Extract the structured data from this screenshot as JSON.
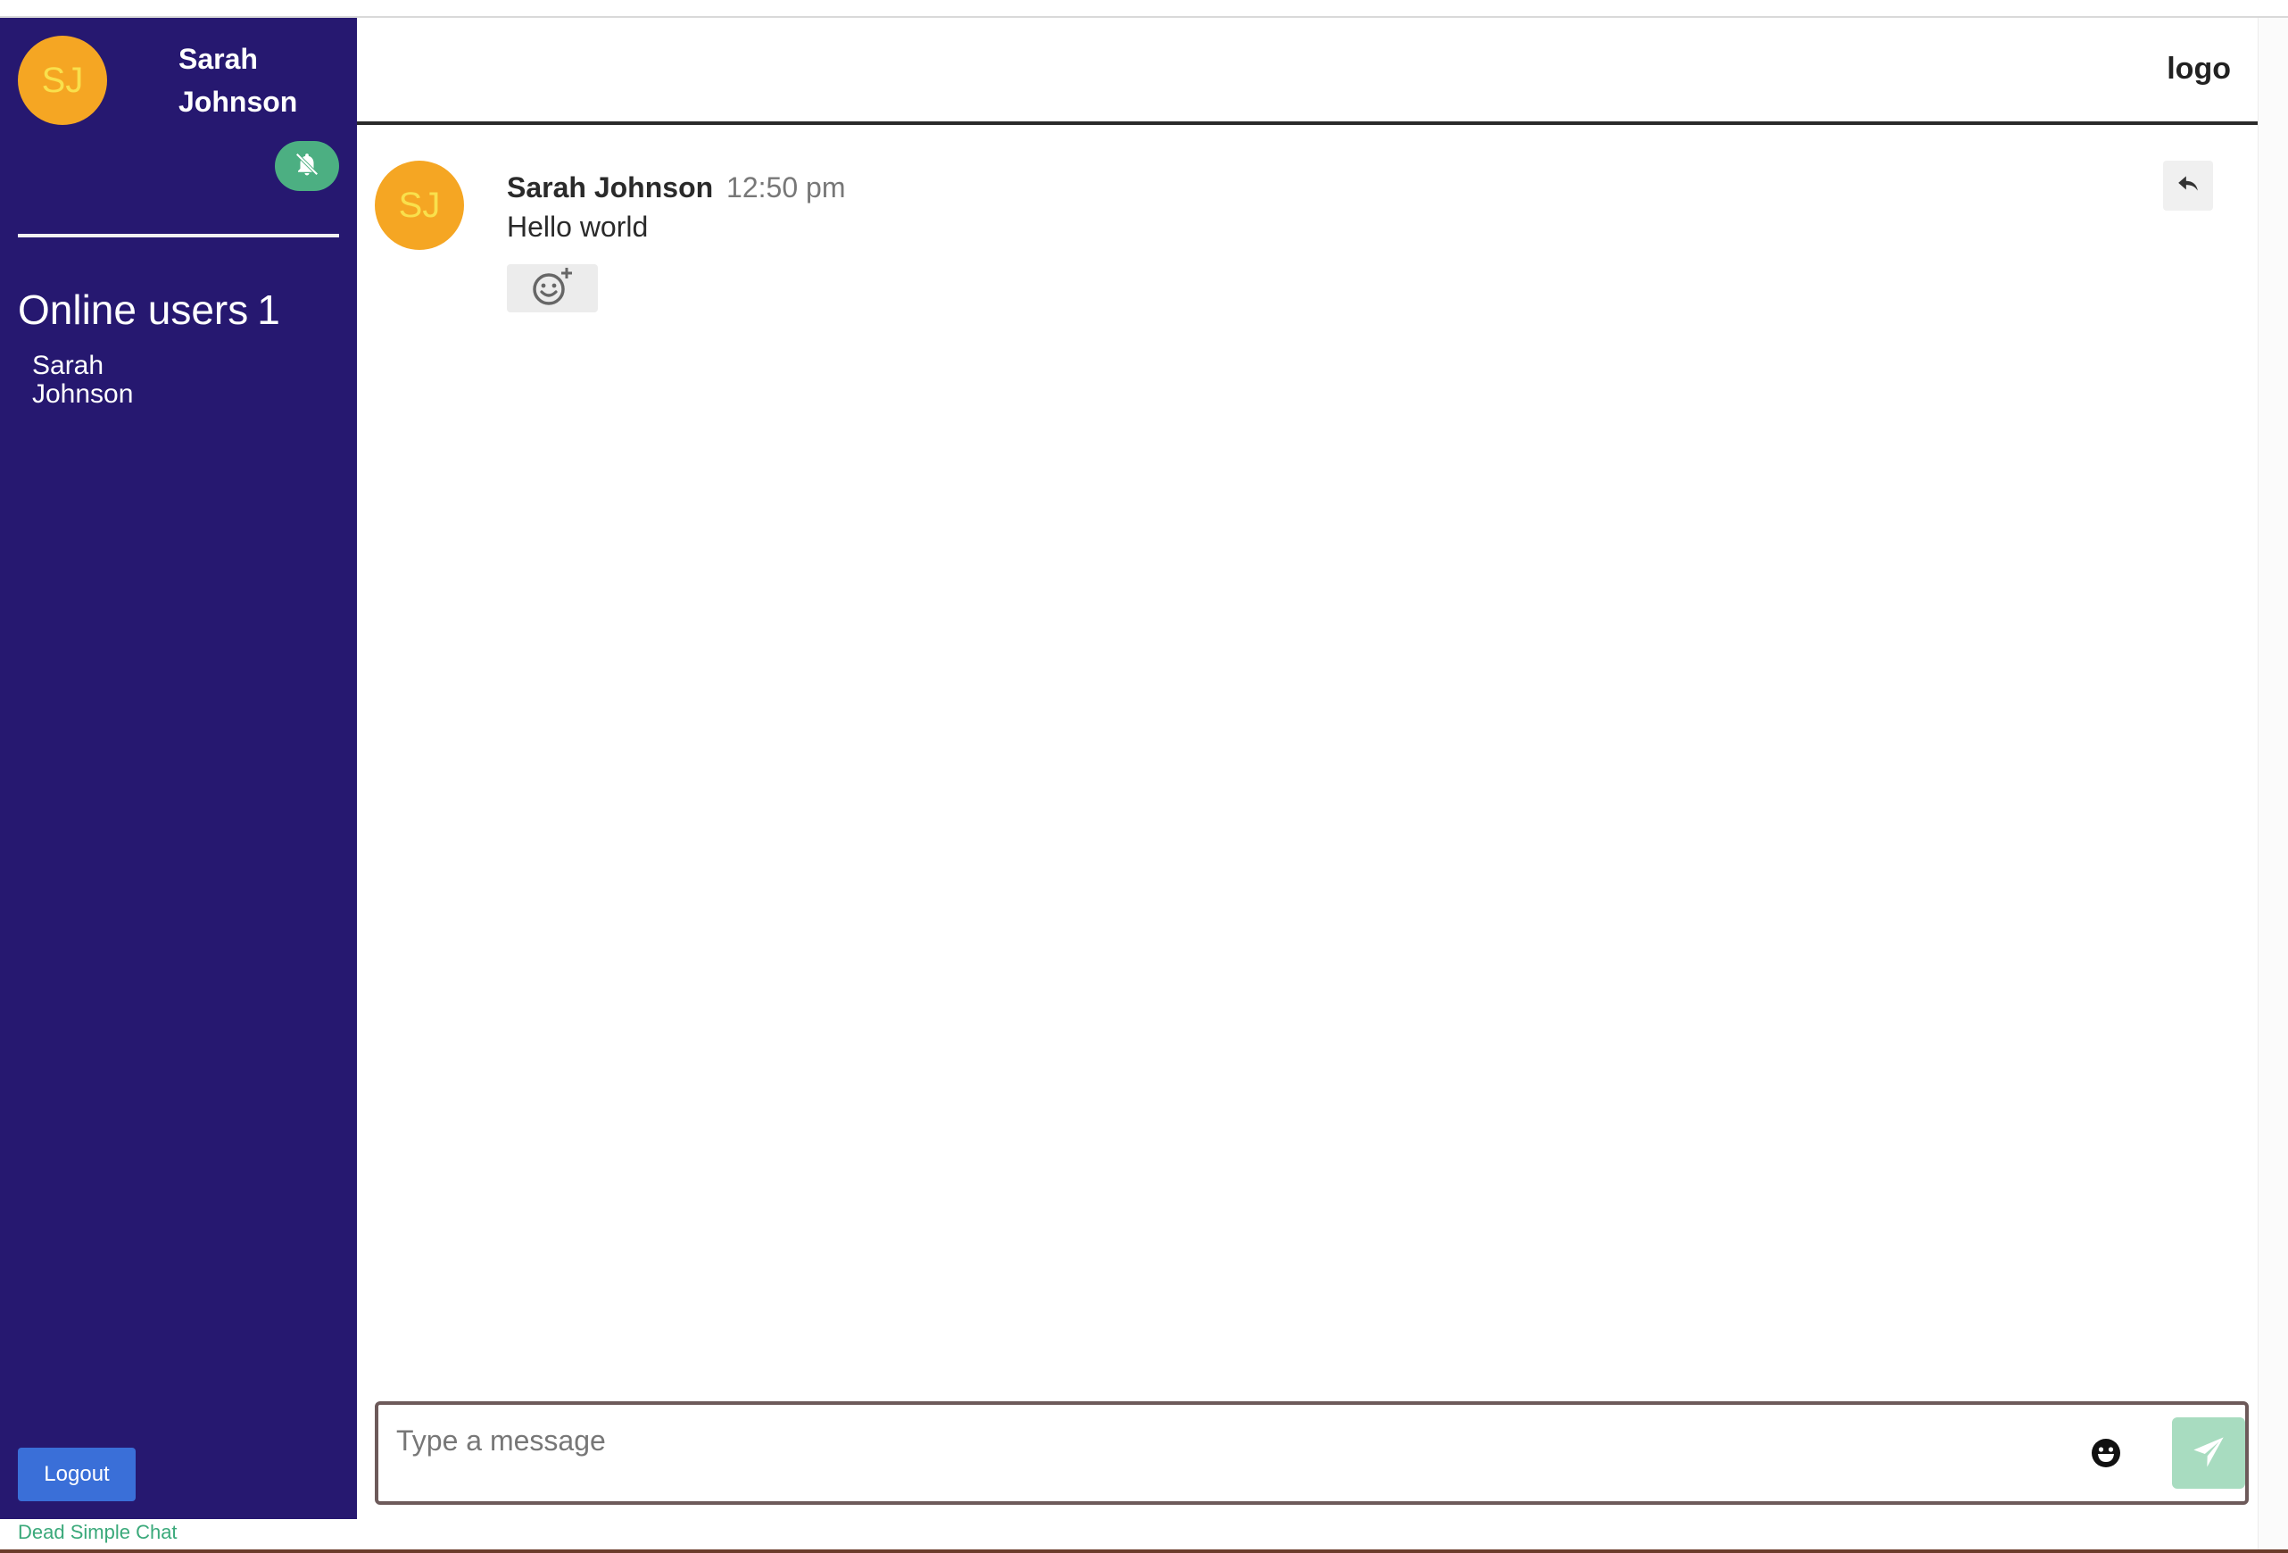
{
  "user": {
    "initials": "SJ",
    "name": "Sarah Johnson",
    "name_line1": "Sarah",
    "name_line2": "Johnson",
    "avatar_color": "#f5a623"
  },
  "sidebar": {
    "online_title": "Online users",
    "online_count": "1",
    "online_users": [
      {
        "line1": "Sarah",
        "line2": "Johnson"
      }
    ],
    "logout_label": "Logout",
    "notification_icon": "bell-off-icon",
    "background_color": "#261870"
  },
  "header": {
    "logo_text": "logo"
  },
  "messages": [
    {
      "initials": "SJ",
      "author": "Sarah Johnson",
      "time": "12:50 pm",
      "text": "Hello world",
      "reaction_icon": "add-reaction-icon",
      "reply_icon": "reply-icon"
    }
  ],
  "composer": {
    "placeholder": "Type a message",
    "value": "",
    "emoji_icon": "emoji-icon",
    "send_icon": "send-icon",
    "send_color": "#a8dcc0"
  },
  "footer": {
    "brand": "Dead Simple Chat"
  }
}
